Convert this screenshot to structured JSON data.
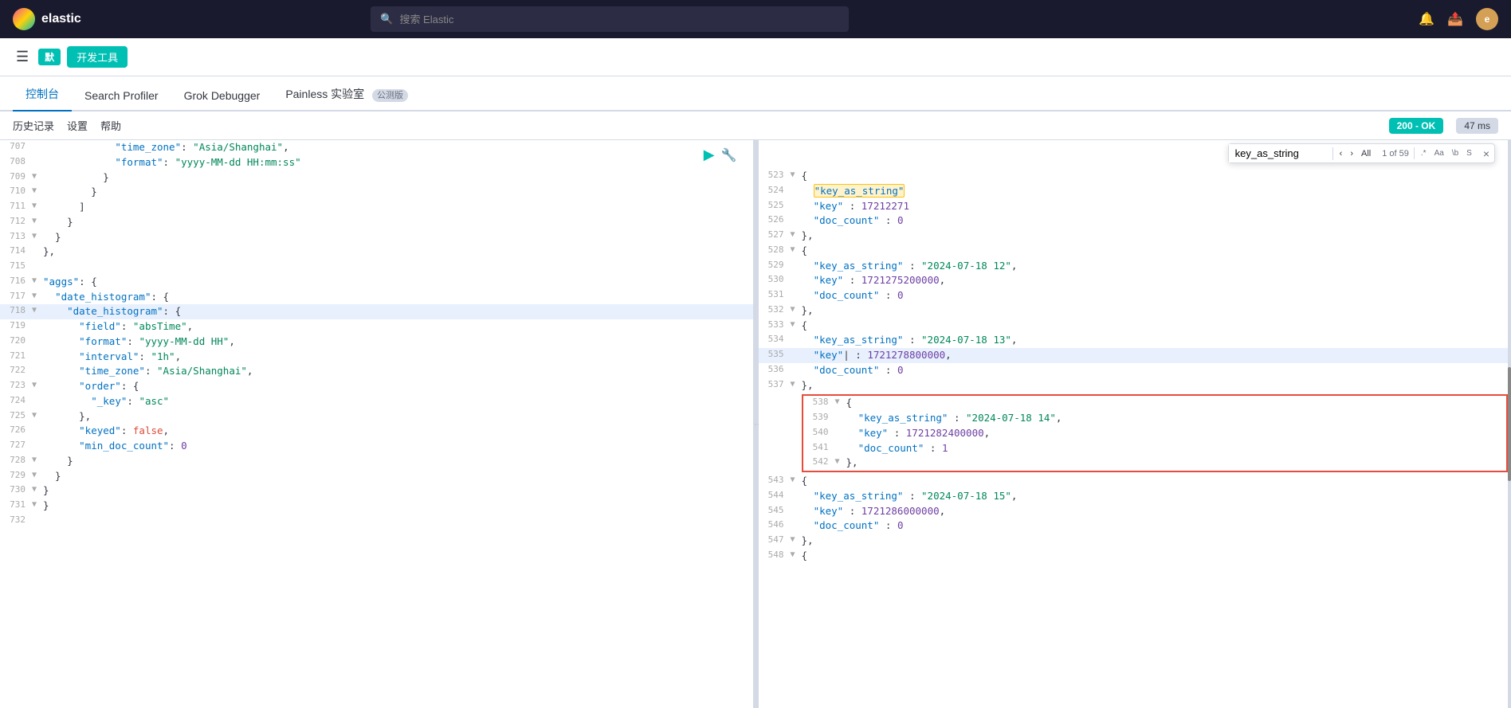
{
  "topbar": {
    "logo_text": "elastic",
    "search_placeholder": "搜索 Elastic",
    "avatar_text": "e"
  },
  "secondary_nav": {
    "default_badge": "默",
    "devtools_label": "开发工具"
  },
  "tabs": [
    {
      "id": "console",
      "label": "控制台",
      "active": true
    },
    {
      "id": "search-profiler",
      "label": "Search Profiler",
      "active": false
    },
    {
      "id": "grok-debugger",
      "label": "Grok Debugger",
      "active": false
    },
    {
      "id": "painless-lab",
      "label": "Painless 实验室",
      "active": false,
      "beta": "公测版"
    }
  ],
  "toolbar": {
    "history_label": "历史记录",
    "settings_label": "设置",
    "help_label": "帮助",
    "status": "200 - OK",
    "time": "47 ms"
  },
  "left_panel": {
    "lines": [
      {
        "num": "707",
        "fold": "",
        "indent": 3,
        "content": "\"time_zone\": \"Asia/Shanghai\",",
        "type": "kv",
        "key": "time_zone",
        "val": "Asia/Shanghai"
      },
      {
        "num": "708",
        "fold": "",
        "indent": 3,
        "content": "\"format\": \"yyyy-MM-dd HH:mm:ss\"",
        "type": "kv",
        "key": "format",
        "val": "yyyy-MM-dd HH:mm:ss"
      },
      {
        "num": "709",
        "fold": "▼",
        "indent": 2,
        "content": "}",
        "type": "brace"
      },
      {
        "num": "710",
        "fold": "▼",
        "indent": 2,
        "content": "}",
        "type": "brace"
      },
      {
        "num": "711",
        "fold": "▼",
        "indent": 1,
        "content": "]",
        "type": "bracket"
      },
      {
        "num": "712",
        "fold": "▼",
        "indent": 1,
        "content": "}",
        "type": "brace"
      },
      {
        "num": "713",
        "fold": "▼",
        "indent": 0,
        "content": "}",
        "type": "brace"
      },
      {
        "num": "714",
        "fold": "",
        "indent": 0,
        "content": "},",
        "type": "brace"
      },
      {
        "num": "715",
        "fold": "",
        "indent": 0,
        "content": "",
        "type": "empty"
      },
      {
        "num": "716",
        "fold": "▼",
        "indent": 0,
        "content": "\"aggs\": {",
        "type": "open_kv",
        "key": "aggs"
      },
      {
        "num": "717",
        "fold": "▼",
        "indent": 1,
        "content": "\"date_histogram\": {",
        "type": "open_kv",
        "key": "date_histogram"
      },
      {
        "num": "718",
        "fold": "▼",
        "indent": 2,
        "content": "\"date_histogram\": {",
        "type": "open_kv",
        "key": "date_histogram",
        "highlighted": true
      },
      {
        "num": "719",
        "fold": "",
        "indent": 3,
        "content": "\"field\": \"absTime\",",
        "type": "kv",
        "key": "field",
        "val": "absTime"
      },
      {
        "num": "720",
        "fold": "",
        "indent": 3,
        "content": "\"format\": \"yyyy-MM-dd HH\",",
        "type": "kv",
        "key": "format",
        "val": "yyyy-MM-dd HH"
      },
      {
        "num": "721",
        "fold": "",
        "indent": 3,
        "content": "\"interval\": \"1h\",",
        "type": "kv",
        "key": "interval",
        "val": "1h"
      },
      {
        "num": "722",
        "fold": "",
        "indent": 3,
        "content": "\"time_zone\": \"Asia/Shanghai\",",
        "type": "kv",
        "key": "time_zone",
        "val": "Asia/Shanghai"
      },
      {
        "num": "723",
        "fold": "▼",
        "indent": 3,
        "content": "\"order\": {",
        "type": "open_kv",
        "key": "order"
      },
      {
        "num": "724",
        "fold": "",
        "indent": 4,
        "content": "\"_key\": \"asc\"",
        "type": "kv",
        "key": "_key",
        "val": "asc"
      },
      {
        "num": "725",
        "fold": "▼",
        "indent": 3,
        "content": "},",
        "type": "close_brace"
      },
      {
        "num": "726",
        "fold": "",
        "indent": 3,
        "content": "\"keyed\": false,",
        "type": "kv_bool",
        "key": "keyed",
        "val": "false"
      },
      {
        "num": "727",
        "fold": "",
        "indent": 3,
        "content": "\"min_doc_count\": 0",
        "type": "kv_num",
        "key": "min_doc_count",
        "val": "0"
      },
      {
        "num": "728",
        "fold": "▼",
        "indent": 2,
        "content": "}",
        "type": "brace"
      },
      {
        "num": "729",
        "fold": "▼",
        "indent": 1,
        "content": "}",
        "type": "brace"
      },
      {
        "num": "730",
        "fold": "▼",
        "indent": 0,
        "content": "}",
        "type": "brace"
      },
      {
        "num": "731",
        "fold": "▼",
        "indent": 0,
        "content": "}",
        "type": "brace"
      },
      {
        "num": "732",
        "fold": "",
        "indent": 0,
        "content": "",
        "type": "empty"
      }
    ]
  },
  "right_panel": {
    "search_box": {
      "value": "key_as_string",
      "match_info": "1 of 59",
      "close_label": "×",
      "prev_label": "‹",
      "next_label": "›",
      "all_label": "All",
      "opt_regex": ".*",
      "opt_aa": "Aa",
      "opt_backslash": "\\b",
      "opt_s": "S"
    },
    "lines": [
      {
        "num": "523",
        "fold": "▼",
        "content": "{",
        "type": "brace"
      },
      {
        "num": "524",
        "fold": "",
        "content": "\"key_as_string\"",
        "type": "key_only",
        "highlight": true
      },
      {
        "num": "525",
        "fold": "",
        "content": "\"key\" : 17212271",
        "type": "kv",
        "key": "key",
        "val_partial": "17212271..."
      },
      {
        "num": "526",
        "fold": "",
        "content": "\"doc_count\" : 0",
        "type": "kv_num",
        "key": "doc_count",
        "val": "0"
      },
      {
        "num": "527",
        "fold": "▼",
        "content": "},",
        "type": "close_brace"
      },
      {
        "num": "528",
        "fold": "▼",
        "content": "{",
        "type": "brace"
      },
      {
        "num": "529",
        "fold": "",
        "content": "\"key_as_string\" : \"2024-07-18 12\",",
        "type": "kv",
        "key": "key_as_string",
        "val": "2024-07-18 12"
      },
      {
        "num": "530",
        "fold": "",
        "content": "\"key\" : 1721275200000,",
        "type": "kv_num",
        "key": "key",
        "val": "1721275200000"
      },
      {
        "num": "531",
        "fold": "",
        "content": "\"doc_count\" : 0",
        "type": "kv_num",
        "key": "doc_count",
        "val": "0"
      },
      {
        "num": "532",
        "fold": "▼",
        "content": "},",
        "type": "close_brace"
      },
      {
        "num": "533",
        "fold": "▼",
        "content": "{",
        "type": "brace"
      },
      {
        "num": "534",
        "fold": "",
        "content": "\"key_as_string\" : \"2024-07-18 13\",",
        "type": "kv",
        "key": "key_as_string",
        "val": "2024-07-18 13"
      },
      {
        "num": "535",
        "fold": "",
        "content": "\"key\" : 1721278800000,",
        "type": "kv_num",
        "key": "key",
        "val": "1721278800000",
        "highlighted": true
      },
      {
        "num": "536",
        "fold": "",
        "content": "\"doc_count\" : 0",
        "type": "kv_num",
        "key": "doc_count",
        "val": "0"
      },
      {
        "num": "537",
        "fold": "▼",
        "content": "},",
        "type": "close_brace"
      },
      {
        "num": "538",
        "fold": "▼",
        "content": "{",
        "type": "brace",
        "box_start": true
      },
      {
        "num": "539",
        "fold": "",
        "content": "\"key_as_string\" : \"2024-07-18 14\",",
        "type": "kv",
        "key": "key_as_string",
        "val": "2024-07-18 14",
        "in_box": true
      },
      {
        "num": "540",
        "fold": "",
        "content": "\"key\" : 1721282400000,",
        "type": "kv_num",
        "key": "key",
        "val": "1721282400000",
        "in_box": true
      },
      {
        "num": "541",
        "fold": "",
        "content": "\"doc_count\" : 1",
        "type": "kv_num",
        "key": "doc_count",
        "val": "1",
        "in_box": true
      },
      {
        "num": "542",
        "fold": "▼",
        "content": "},",
        "type": "close_brace",
        "box_end": true
      },
      {
        "num": "543",
        "fold": "▼",
        "content": "{",
        "type": "brace"
      },
      {
        "num": "544",
        "fold": "",
        "content": "\"key_as_string\" : \"2024-07-18 15\",",
        "type": "kv",
        "key": "key_as_string",
        "val": "2024-07-18 15"
      },
      {
        "num": "545",
        "fold": "",
        "content": "\"key\" : 1721286000000,",
        "type": "kv_num",
        "key": "key",
        "val": "1721286000000"
      },
      {
        "num": "546",
        "fold": "",
        "content": "\"doc_count\" : 0",
        "type": "kv_num",
        "key": "doc_count",
        "val": "0"
      },
      {
        "num": "547",
        "fold": "▼",
        "content": "},",
        "type": "close_brace"
      },
      {
        "num": "548",
        "fold": "▼",
        "content": "{",
        "type": "brace"
      }
    ]
  },
  "icons": {
    "hamburger": "☰",
    "search": "🔍",
    "run": "▶",
    "wrench": "🔧",
    "bell": "🔔",
    "share": "📤",
    "prev": "‹",
    "next": "›"
  }
}
